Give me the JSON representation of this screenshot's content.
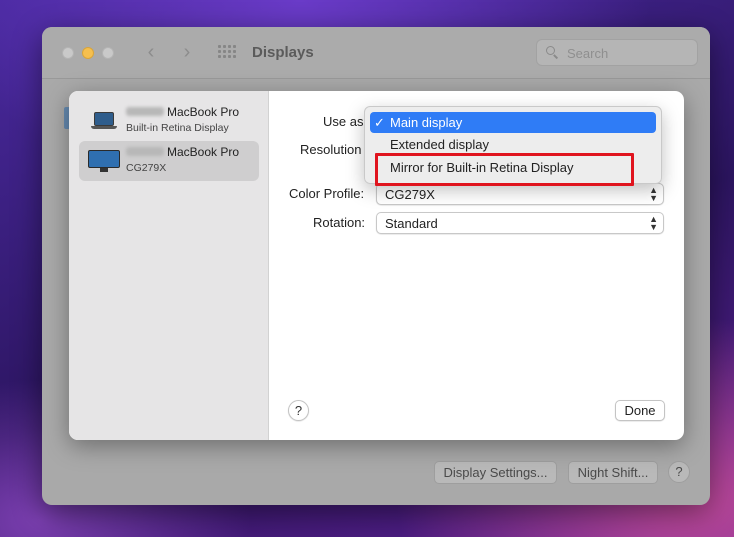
{
  "window": {
    "title": "Displays",
    "search_placeholder": "Search",
    "nav_back": "‹",
    "nav_forward": "›",
    "buttons": {
      "display_settings": "Display Settings...",
      "night_shift": "Night Shift...",
      "help": "?"
    }
  },
  "sheet": {
    "displays": [
      {
        "name": "MacBook Pro",
        "subtitle": "Built-in Retina Display",
        "icon": "laptop-icon",
        "selected": false
      },
      {
        "name": "MacBook Pro",
        "subtitle": "CG279X",
        "icon": "monitor-icon",
        "selected": true
      }
    ],
    "labels": {
      "use_as": "Use as",
      "resolution": "Resolution",
      "color_profile": "Color Profile:",
      "rotation": "Rotation:"
    },
    "color_profile_value": "CG279X",
    "rotation_value": "Standard",
    "help": "?",
    "done": "Done",
    "chevron_glyph": "⌃⌄"
  },
  "dropdown": {
    "check": "✓",
    "items": [
      {
        "label": "Main display",
        "checked": true,
        "highlighted": true
      },
      {
        "label": "Extended display",
        "checked": false,
        "highlighted": false
      },
      {
        "label": "Mirror for Built-in Retina Display",
        "checked": false,
        "highlighted": false
      }
    ]
  },
  "colors": {
    "accent": "#2f7cf6",
    "annotation_red": "#e0141e",
    "traffic_yellow": "#f5bf4f"
  }
}
